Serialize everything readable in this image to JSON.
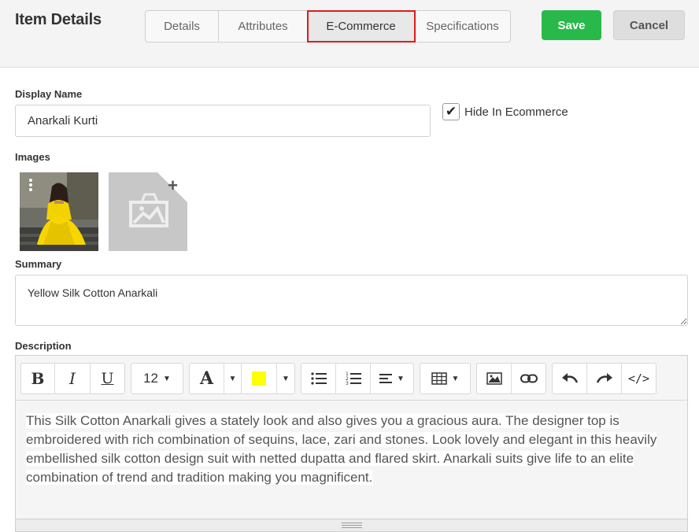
{
  "header": {
    "title": "Item Details",
    "tabs": [
      {
        "label": "Details"
      },
      {
        "label": "Attributes"
      },
      {
        "label": "E-Commerce",
        "active": true
      },
      {
        "label": "Specifications"
      }
    ],
    "save_label": "Save",
    "cancel_label": "Cancel"
  },
  "form": {
    "display_name": {
      "label": "Display Name",
      "value": "Anarkali Kurti"
    },
    "hide_in_ecommerce": {
      "label": "Hide In Ecommerce",
      "checked": true
    },
    "images": {
      "label": "Images"
    },
    "summary": {
      "label": "Summary",
      "value": "Yellow Silk Cotton Anarkali"
    },
    "description": {
      "label": "Description",
      "font_size": "12",
      "highlight_color": "#ffff00",
      "content": "This Silk Cotton Anarkali gives a stately look and also gives you a gracious aura. The designer top is embroidered with rich combination of sequins, lace, zari and stones. Look lovely and elegant in this heavily embellished silk cotton design suit with netted dupatta and flared skirt. Anarkali suits give life to an elite combination of trend and tradition making you magnificent."
    }
  },
  "colors": {
    "save": "#28b94a",
    "active_tab_outline": "#e01b1b"
  }
}
